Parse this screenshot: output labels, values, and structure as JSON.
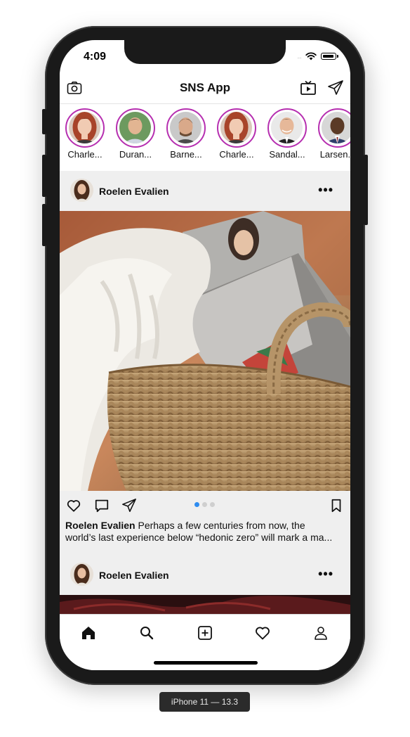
{
  "status_bar": {
    "time": "4:09",
    "signal_dots": "...."
  },
  "navbar": {
    "title": "SNS App"
  },
  "stories": [
    {
      "name": "Charle..."
    },
    {
      "name": "Duran..."
    },
    {
      "name": "Barne..."
    },
    {
      "name": "Charle..."
    },
    {
      "name": "Sandal..."
    },
    {
      "name": "Larsen..."
    }
  ],
  "posts": [
    {
      "username": "Roelen Evalien",
      "more": "•••",
      "caption_user": "Roelen Evalien",
      "caption_line1": " Perhaps a few centuries from now, the",
      "caption_line2": "world’s last experience below “hedonic zero” will mark a ma..."
    },
    {
      "username": "Roelen Evalien",
      "more": "•••"
    }
  ],
  "carousel": {
    "pages": 3,
    "active": 1
  },
  "device_label": "iPhone 11 — 13.3",
  "colors": {
    "story_ring": "#b62fb0",
    "page_dot_active": "#2e8cf0"
  },
  "icons": [
    "camera-icon",
    "tv-icon",
    "send-icon",
    "heart-icon",
    "comment-icon",
    "share-icon",
    "bookmark-icon",
    "home-icon",
    "search-icon",
    "add-post-icon",
    "activity-heart-icon",
    "profile-icon"
  ]
}
